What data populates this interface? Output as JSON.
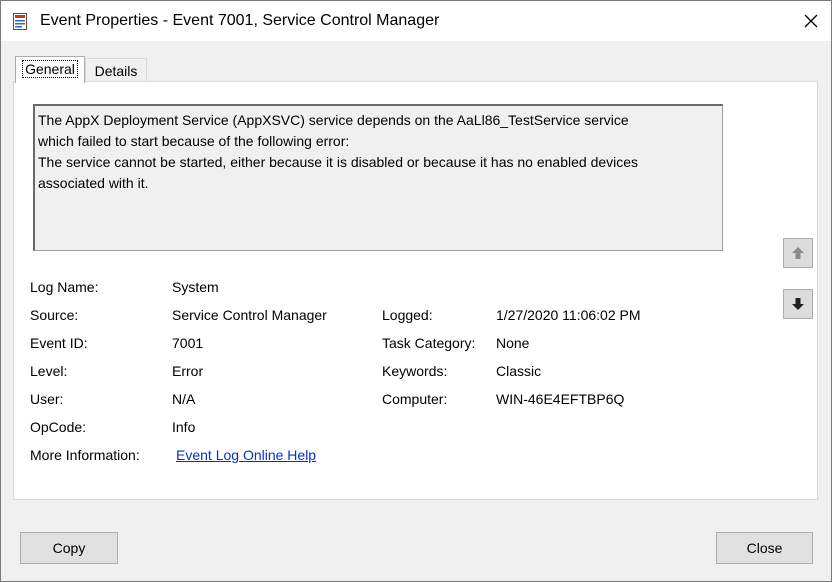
{
  "window": {
    "title": "Event Properties - Event 7001, Service Control Manager",
    "icon": "event-viewer-icon",
    "close_glyph": "✕"
  },
  "tabs": [
    {
      "label": "General",
      "selected": true
    },
    {
      "label": "Details",
      "selected": false
    }
  ],
  "description": {
    "lines": [
      "The AppX Deployment Service (AppXSVC) service depends on the AaLl86_TestService service",
      "which failed to start because of the following error:",
      "The service cannot be started, either because it is disabled or because it has no enabled devices",
      "associated with it."
    ]
  },
  "fields": {
    "log_name": {
      "label": "Log Name:",
      "value": "System"
    },
    "source": {
      "label": "Source:",
      "value": "Service Control Manager"
    },
    "logged": {
      "label": "Logged:",
      "value": "1/27/2020 11:06:02 PM"
    },
    "event_id": {
      "label": "Event ID:",
      "value": "7001"
    },
    "task_category": {
      "label": "Task Category:",
      "value": "None"
    },
    "level": {
      "label": "Level:",
      "value": "Error"
    },
    "keywords": {
      "label": "Keywords:",
      "value": "Classic"
    },
    "user": {
      "label": "User:",
      "value": "N/A"
    },
    "computer": {
      "label": "Computer:",
      "value": "WIN-46E4EFTBP6Q"
    },
    "opcode": {
      "label": "OpCode:",
      "value": "Info"
    },
    "more_info": {
      "label": "More Information:",
      "link": "Event Log Online Help"
    }
  },
  "buttons": {
    "copy": "Copy",
    "close": "Close"
  },
  "nav": {
    "up_icon": "arrow-up-icon",
    "down_icon": "arrow-down-icon"
  }
}
